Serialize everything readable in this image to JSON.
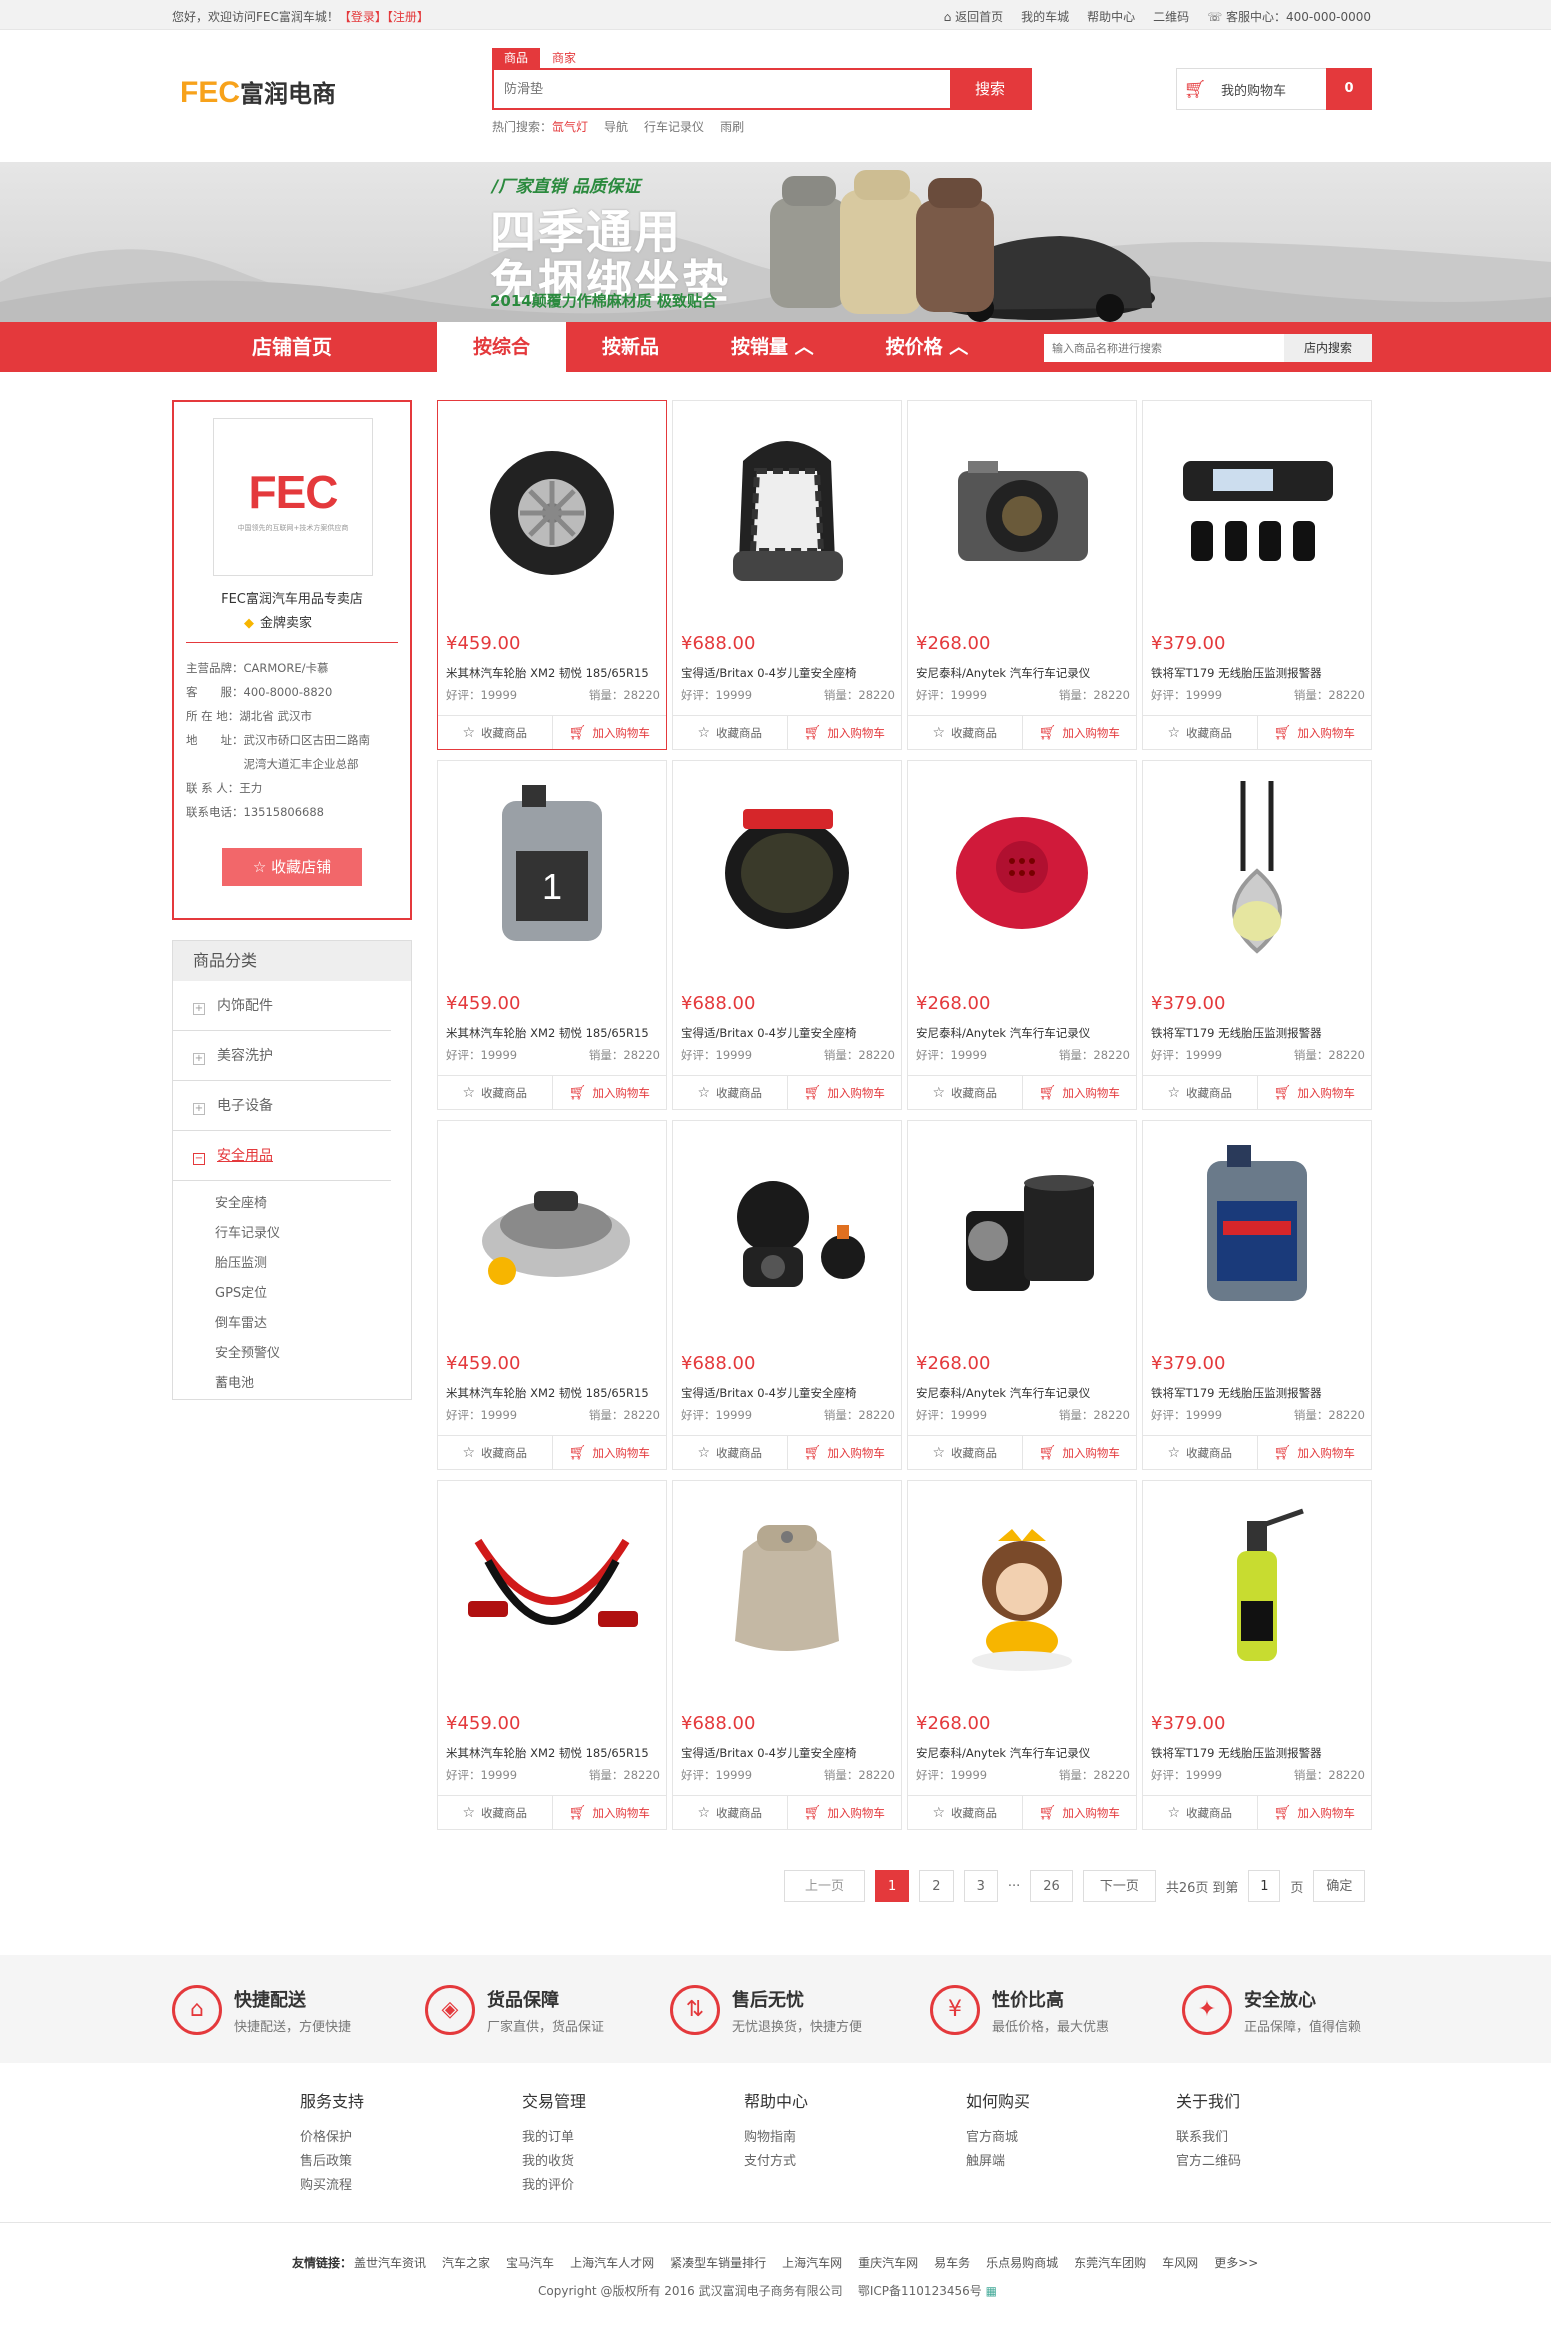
{
  "topbar": {
    "welcome": "您好，欢迎访问FEC富润车城！",
    "login": "【登录】",
    "register": "【注册】",
    "links": [
      "返回首页",
      "我的车城",
      "帮助中心",
      "二维码",
      "客服中心：400-000-0000"
    ]
  },
  "header": {
    "logo_text": "FEC",
    "logo_cn": "富润电商",
    "search_tabs": [
      "商品",
      "商家"
    ],
    "search_placeholder": "防滑垫",
    "search_button": "搜索",
    "hot_label": "热门搜索：",
    "hot_terms": [
      "氙气灯",
      "导航",
      "行车记录仪",
      "雨刷"
    ],
    "cart_label": "我的购物车",
    "cart_count": "0"
  },
  "banner": {
    "tag": "厂家直销 品质保证",
    "line1": "四季通用",
    "line2": "免捆绑坐垫",
    "line3": "2014颠覆力作棉麻材质 极致贴合"
  },
  "nav": {
    "home": "店铺首页",
    "sorts": [
      "按综合",
      "按新品",
      "按销量 ︿",
      "按价格 ︿"
    ],
    "search_placeholder": "输入商品名称进行搜索",
    "search_button": "店内搜索"
  },
  "shop": {
    "logo": "FEC",
    "logo_sub": "中国领先的互联网+技术方案供应商",
    "name": "FEC富润汽车用品专卖店",
    "level": "金牌卖家",
    "info": [
      "主营品牌：CARMORE/卡慕",
      "客　　服：400-8000-8820",
      "所 在 地：湖北省 武汉市",
      "地　　址：武汉市硚口区古田二路南",
      "　　　　　泥湾大道汇丰企业总部",
      "联 系 人：王力",
      "联系电话：13515806688"
    ],
    "fav_button": "收藏店铺"
  },
  "category": {
    "header": "商品分类",
    "items": [
      "内饰配件",
      "美容洗护",
      "电子设备",
      "安全用品"
    ],
    "active_sub": [
      "安全座椅",
      "行车记录仪",
      "胎压监测",
      "GPS定位",
      "倒车雷达",
      "安全预警仪",
      "蓄电池"
    ]
  },
  "product_text": {
    "fav": "收藏商品",
    "add": "加入购物车",
    "good_label": "好评：19999",
    "sales_label": "销量：28220"
  },
  "products": [
    {
      "price": "¥459.00",
      "title": "米其林汽车轮胎 XM2 韧悦 185/65R15",
      "icon": "tire"
    },
    {
      "price": "¥688.00",
      "title": "宝得适/Britax 0-4岁儿童安全座椅",
      "icon": "child-seat"
    },
    {
      "price": "¥268.00",
      "title": "安尼泰科/Anytek 汽车行车记录仪",
      "icon": "camera"
    },
    {
      "price": "¥379.00",
      "title": "铁将军T179 无线胎压监测报警器",
      "icon": "tpms"
    },
    {
      "price": "¥459.00",
      "title": "米其林汽车轮胎 XM2 韧悦 185/65R15",
      "icon": "oil-bottle"
    },
    {
      "price": "¥688.00",
      "title": "宝得适/Britax 0-4岁儿童安全座椅",
      "icon": "tape-roll"
    },
    {
      "price": "¥268.00",
      "title": "安尼泰科/Anytek 汽车行车记录仪",
      "icon": "speaker"
    },
    {
      "price": "¥379.00",
      "title": "铁将军T179 无线胎压监测报警器",
      "icon": "perfume-pendant"
    },
    {
      "price": "¥459.00",
      "title": "米其林汽车轮胎 XM2 韧悦 185/65R15",
      "icon": "air-freshener"
    },
    {
      "price": "¥688.00",
      "title": "宝得适/Britax 0-4岁儿童安全座椅",
      "icon": "dashcam"
    },
    {
      "price": "¥268.00",
      "title": "安尼泰科/Anytek 汽车行车记录仪",
      "icon": "oil-filter"
    },
    {
      "price": "¥379.00",
      "title": "铁将军T179 无线胎压监测报警器",
      "icon": "oil-bottle-blue"
    },
    {
      "price": "¥459.00",
      "title": "米其林汽车轮胎 XM2 韧悦 185/65R15",
      "icon": "jumper-cables"
    },
    {
      "price": "¥688.00",
      "title": "宝得适/Britax 0-4岁儿童安全座椅",
      "icon": "lumbar-pillow"
    },
    {
      "price": "¥268.00",
      "title": "安尼泰科/Anytek 汽车行车记录仪",
      "icon": "monkey-doll"
    },
    {
      "price": "¥379.00",
      "title": "铁将军T179 无线胎压监测报警器",
      "icon": "sprayer"
    }
  ],
  "pager": {
    "prev": "上一页",
    "pages": [
      "1",
      "2",
      "3"
    ],
    "ellipsis": "···",
    "last": "26",
    "next": "下一页",
    "total": "共26页",
    "goto": "到第",
    "goto_value": "1",
    "page_unit": "页",
    "confirm": "确定"
  },
  "services": [
    {
      "title": "快捷配送",
      "desc": "快捷配送，方便快捷",
      "icon": "store"
    },
    {
      "title": "货品保障",
      "desc": "厂家直供，货品保证",
      "icon": "tag"
    },
    {
      "title": "售后无忧",
      "desc": "无忧退换货，快捷方便",
      "icon": "return"
    },
    {
      "title": "性价比高",
      "desc": "最低价格，最大优惠",
      "icon": "money-bag"
    },
    {
      "title": "安全放心",
      "desc": "正品保障，值得信赖",
      "icon": "gift"
    }
  ],
  "footer": {
    "columns": [
      {
        "title": "服务支持",
        "links": [
          "价格保护",
          "售后政策",
          "购买流程"
        ]
      },
      {
        "title": "交易管理",
        "links": [
          "我的订单",
          "我的收货",
          "我的评价"
        ]
      },
      {
        "title": "帮助中心",
        "links": [
          "购物指南",
          "支付方式"
        ]
      },
      {
        "title": "如何购买",
        "links": [
          "官方商城",
          "触屏端"
        ]
      },
      {
        "title": "关于我们",
        "links": [
          "联系我们",
          "官方二维码"
        ]
      }
    ],
    "friend_label": "友情链接：",
    "friend_links": [
      "盖世汽车资讯",
      "汽车之家",
      "宝马汽车",
      "上海汽车人才网",
      "紧凑型车销量排行",
      "上海汽车网",
      "重庆汽车网",
      "易车务",
      "乐点易购商城",
      "东莞汽车团购",
      "车风网",
      "更多>>"
    ],
    "copyright": "Copyright @版权所有 2016 武汉富润电子商务有限公司    鄂ICP备110123456号"
  },
  "colors": {
    "accent": "#e4393c",
    "logo_orange": "#f7a21b"
  }
}
